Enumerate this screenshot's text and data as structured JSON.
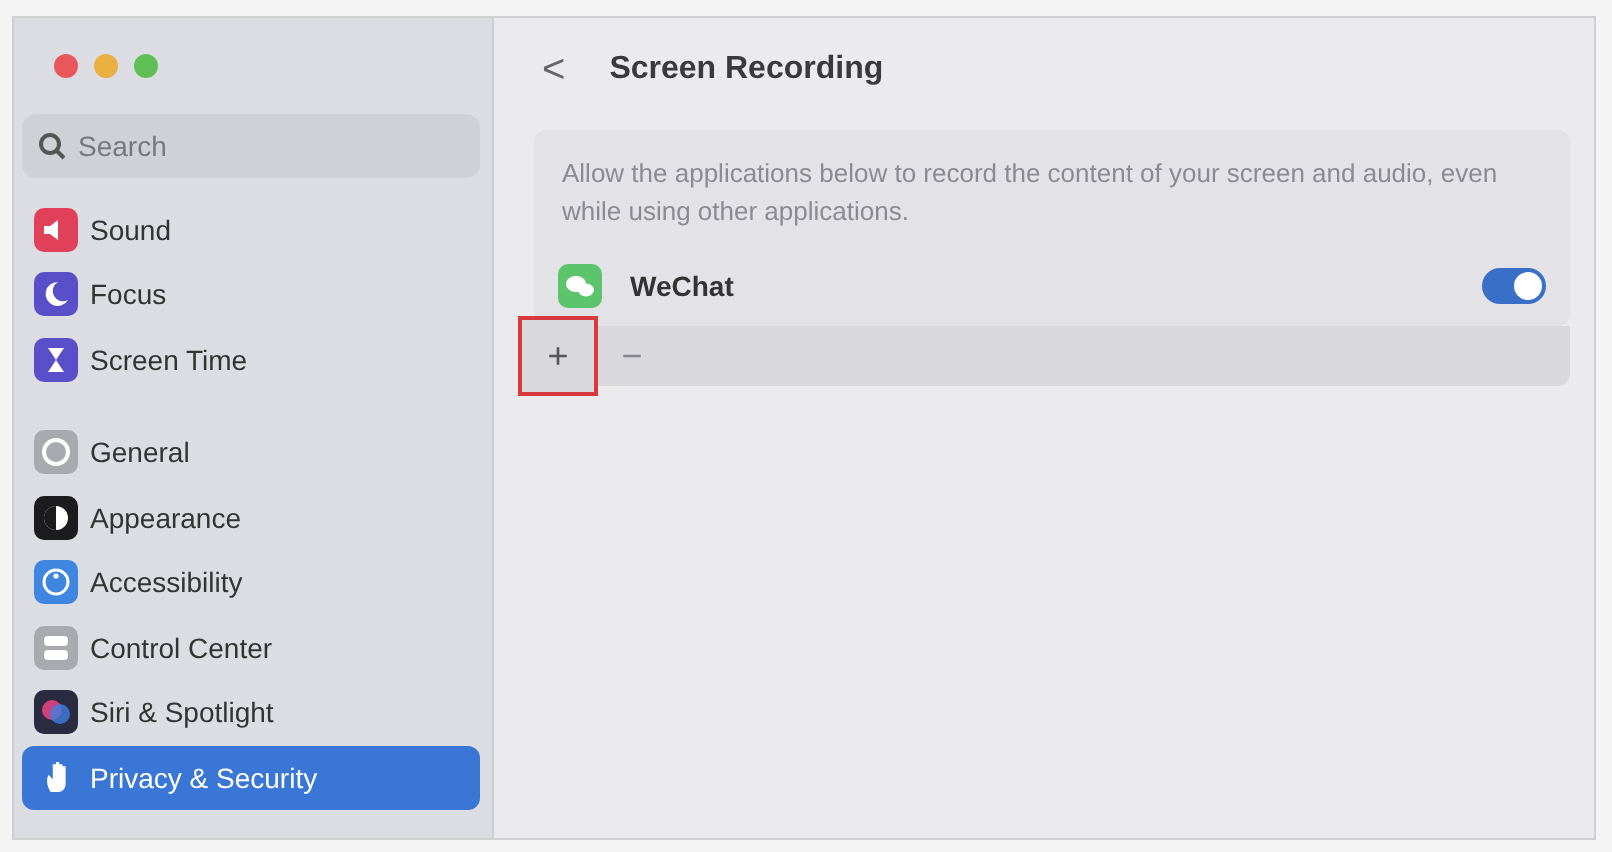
{
  "sidebar": {
    "search": {
      "placeholder": "Search"
    },
    "groups": [
      {
        "items": [
          {
            "label": "Sound",
            "selected": false
          },
          {
            "label": "Focus",
            "selected": false
          },
          {
            "label": "Screen Time",
            "selected": false
          }
        ]
      },
      {
        "items": [
          {
            "label": "General",
            "selected": false
          },
          {
            "label": "Appearance",
            "selected": false
          },
          {
            "label": "Accessibility",
            "selected": false
          },
          {
            "label": "Control Center",
            "selected": false
          },
          {
            "label": "Siri & Spotlight",
            "selected": false
          },
          {
            "label": "Privacy & Security",
            "selected": true
          }
        ]
      }
    ]
  },
  "header": {
    "back": "<",
    "title": "Screen Recording"
  },
  "description": "Allow the applications below to record the content of your screen and audio, even while using other applications.",
  "apps": [
    {
      "name": "WeChat",
      "on": true
    }
  ],
  "footer": {
    "add": {
      "label": "+",
      "highlighted": true
    },
    "remove": {
      "label": "−",
      "disabled": true
    }
  }
}
